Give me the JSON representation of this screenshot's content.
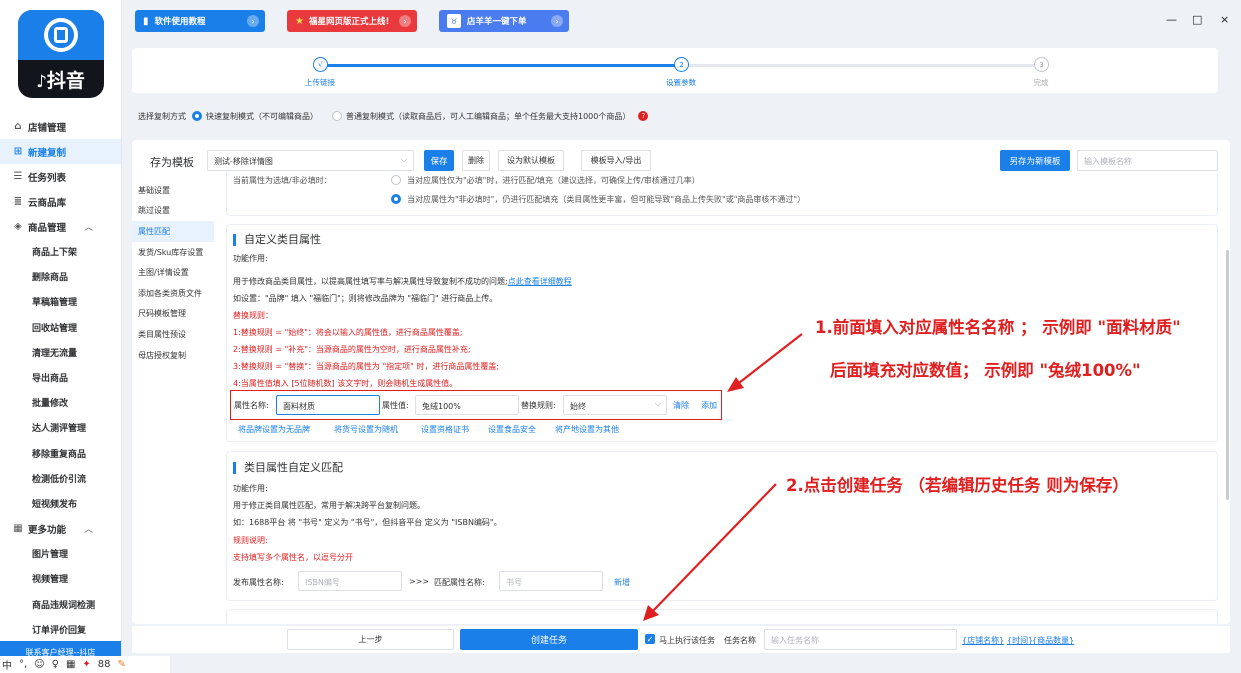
{
  "logo": {
    "text": "抖音"
  },
  "sidebar": {
    "items": [
      {
        "label": "店铺管理",
        "icon": "shop-icon"
      },
      {
        "label": "新建复制",
        "icon": "plus-square-icon"
      },
      {
        "label": "任务列表",
        "icon": "list-icon"
      },
      {
        "label": "云商品库",
        "icon": "cloud-list-icon"
      },
      {
        "label": "商品管理",
        "icon": "cube-icon"
      }
    ],
    "product_sub": [
      "商品上下架",
      "删除商品",
      "草稿箱管理",
      "回收站管理",
      "清理无流量",
      "导出商品",
      "批量修改",
      "达人测评管理",
      "移除重复商品",
      "检测低价引流",
      "短视频发布"
    ],
    "more": {
      "label": "更多功能",
      "icon": "grid-icon"
    },
    "more_sub": [
      "图片管理",
      "视频管理",
      "商品违规词检测",
      "订单评价回复"
    ],
    "contact": "联系客户经理--抖店"
  },
  "topbar": {
    "tutorial": "软件使用教程",
    "web_launch": "福星网页版正式上线!",
    "order": "店羊羊一键下单",
    "minimize": "—",
    "maximize": "□",
    "close": "×"
  },
  "steps": {
    "items": [
      {
        "label": "上传链接",
        "mark": "√"
      },
      {
        "label": "设置参数",
        "mark": "2"
      },
      {
        "label": "完成",
        "mark": "3"
      }
    ]
  },
  "mode": {
    "label": "选择复制方式",
    "fast": "快速复制模式（不可编辑商品）",
    "normal": "普通复制模式（读取商品后，可人工编辑商品；单个任务最大支持1000个商品）",
    "help": "?"
  },
  "template": {
    "label": "存为模板",
    "selected": "测试-移除详情图",
    "save": "保存",
    "delete": "删除",
    "set_default": "设为默认模板",
    "import_export": "模板导入/导出",
    "save_new": "另存为新模板",
    "name_placeholder": "输入模板名称"
  },
  "left_menu": [
    "基础设置",
    "跳过设置",
    "属性匹配",
    "发货/Sku库存设置",
    "主图/详情设置",
    "添加各类资质文件",
    "尺码模板管理",
    "类目属性预设",
    "母店授权复制"
  ],
  "top_partial": {
    "label": "当前属性为选填/非必填时：",
    "opt1": "当对应属性仅为\"必填\"时，进行匹配/填充（建议选择，可确保上传/审核通过几率）",
    "opt2": "当对应属性为\"非必填时\"，仍进行匹配填充（类目属性更丰富，但可能导致\"商品上传失败\"或\"商品审核不通过\"）"
  },
  "custom_attr": {
    "title": "自定义类目属性",
    "func": "功能作用:",
    "desc": "用于修改商品类目属性，以提高属性填写率与解决属性导致复制不成功的问题;",
    "desc_link": "点此查看详细教程",
    "example": "如设置：\"品牌\" 填入 \"福临门\"；则将修改品牌为 \"福临门\" 进行商品上传。",
    "rules_title": "替换规则：",
    "rules": [
      "1:替换规则 = \"始终\"：将会以输入的属性值，进行商品属性覆盖;",
      "2:替换规则 = \"补充\"：当源商品的属性为空时，进行商品属性补充;",
      "3:替换规则 = \"替换\"：当源商品的属性为 \"指定项\" 时，进行商品属性覆盖;",
      "4:当属性值填入 [5位随机数] 该文字时，则会随机生成属性值。"
    ],
    "attr_name_label": "属性名称:",
    "attr_name_value": "面料材质",
    "attr_value_label": "属性值:",
    "attr_value_value": "兔绒100%",
    "rule_label": "替换规则:",
    "rule_value": "始终",
    "clear": "清除",
    "add": "添加",
    "quick_links": [
      "将品牌设置为无品牌",
      "将货号设置为随机",
      "设置资格证书",
      "设置食品安全",
      "将产地设置为其他"
    ]
  },
  "match": {
    "title": "类目属性自定义匹配",
    "func": "功能作用:",
    "desc": "用于修正类目属性匹配，常用于解决跨平台复制问题。",
    "example": "如：1688平台 将 \"书号\" 定义为 \"书号\"，但抖音平台 定义为 \"ISBN编码\"。",
    "rule_title": "规则说明:",
    "rule": "支持填写多个属性名，以逗号分开",
    "publish_label": "发布属性名称:",
    "publish_placeholder": "ISBN编号",
    "arrow": ">>>",
    "match_label": "匹配属性名称:",
    "match_placeholder": "书号",
    "add": "新增"
  },
  "annotations": {
    "a1": "1.前面填入对应属性名名称 ； 示例即 \"面料材质\"",
    "a2": "后面填充对应数值； 示例即 \"兔绒100%\"",
    "a3": "2.点击创建任务 （若编辑历史任务 则为保存）"
  },
  "bottom": {
    "prev": "上一步",
    "create": "创建任务",
    "run_now": "马上执行该任务",
    "task_name_label": "任务名称",
    "task_name_placeholder": "输入任务名称",
    "tags": [
      "{店铺名称}",
      "{时间}",
      "{商品数量}"
    ]
  },
  "taskbar": {
    "items": [
      "中",
      "°,",
      "☺",
      "♀",
      "▦",
      "✦",
      "88",
      "✎"
    ]
  },
  "colors": {
    "accent": "#1a7fe8",
    "annotation": "#e02020",
    "tutorial": "#1a7fe8",
    "web_launch": "#e9393d",
    "order": "#4a7cf0"
  }
}
